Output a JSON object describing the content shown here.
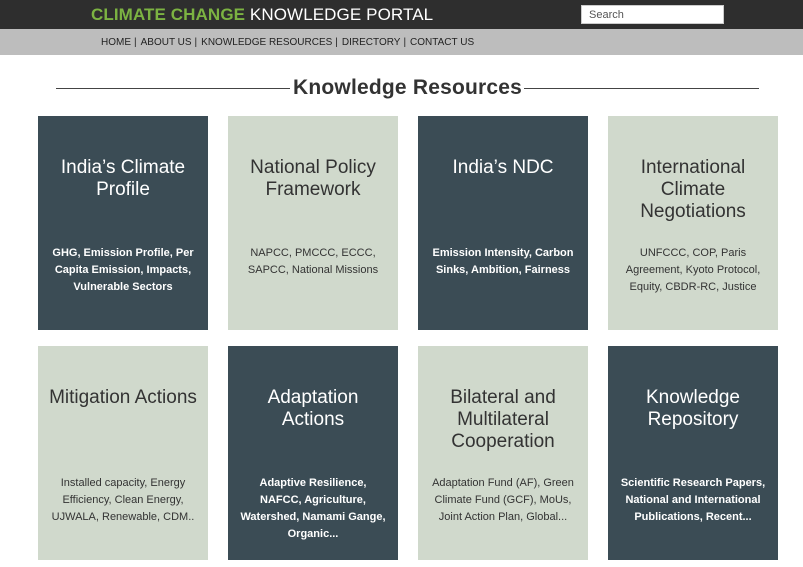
{
  "header": {
    "brand_accent": "CLIMATE CHANGE",
    "brand_rest": "KNOWLEDGE PORTAL",
    "search_placeholder": "Search",
    "colors": {
      "topbar": "#2e2e2e",
      "accent": "#7cb342",
      "navbar": "#bdbdbd"
    }
  },
  "nav": {
    "items": [
      "HOME",
      "ABOUT US",
      "KNOWLEDGE RESOURCES",
      "DIRECTORY",
      "CONTACT US"
    ],
    "separator": "|"
  },
  "section": {
    "title": "Knowledge Resources"
  },
  "cards": [
    {
      "title": "India’s Climate Profile",
      "desc": "GHG, Emission Profile, Per Capita Emission, Impacts, Vulnerable Sectors",
      "theme": "dark"
    },
    {
      "title": "National Policy Framework",
      "desc": "NAPCC, PMCCC, ECCC, SAPCC, National Missions",
      "theme": "light"
    },
    {
      "title": "India’s NDC",
      "desc": "Emission Intensity, Carbon Sinks, Ambition, Fairness",
      "theme": "dark"
    },
    {
      "title": "International Climate Negotiations",
      "desc": "UNFCCC, COP, Paris Agreement, Kyoto Protocol, Equity, CBDR-RC, Justice",
      "theme": "light"
    },
    {
      "title": "Mitigation Actions",
      "desc": "Installed capacity, Energy Efficiency, Clean Energy, UJWALA, Renewable, CDM..",
      "theme": "light"
    },
    {
      "title": "Adaptation Actions",
      "desc": "Adaptive Resilience, NAFCC, Agriculture, Watershed, Namami Gange, Organic...",
      "theme": "dark"
    },
    {
      "title": "Bilateral and Multilateral Cooperation",
      "desc": "Adaptation Fund (AF), Green Climate Fund (GCF), MoUs, Joint Action Plan, Global...",
      "theme": "light"
    },
    {
      "title": "Knowledge Repository",
      "desc": "Scientific Research Papers, National and International Publications, Recent...",
      "theme": "dark"
    }
  ]
}
